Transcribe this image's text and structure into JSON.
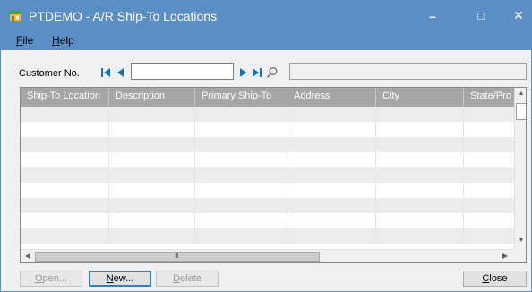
{
  "window": {
    "title": "PTDEMO - A/R Ship-To Locations",
    "minimize_glyph": "–",
    "maximize_glyph": "□",
    "close_glyph": "✕"
  },
  "menu": {
    "file": {
      "underline": "F",
      "rest": "ile"
    },
    "help": {
      "underline": "H",
      "rest": "elp"
    }
  },
  "customer": {
    "label": "Customer No.",
    "value": "",
    "name_value": ""
  },
  "icons": {
    "first": "first-record-icon",
    "previous": "previous-record-icon",
    "next": "next-record-icon",
    "last": "last-record-icon",
    "lookup": "lookup-magnifier-icon"
  },
  "colors": {
    "title_bar": "#5a8ec4",
    "nav_arrow": "#1a6fb5",
    "grid_header": "#a6a6a6"
  },
  "grid": {
    "columns": [
      "Ship-To Location",
      "Description",
      "Primary Ship-To",
      "Address",
      "City",
      "State/Pro"
    ],
    "scroll_up": "▲",
    "scroll_down": "▼",
    "scroll_left": "◀",
    "scroll_right": "▶",
    "grip": "III"
  },
  "buttons": {
    "open": {
      "underline": "O",
      "rest": "pen..."
    },
    "new": {
      "underline": "N",
      "rest": "ew..."
    },
    "delete": {
      "underline": "D",
      "rest": "elete"
    },
    "close": {
      "underline": "C",
      "rest": "lose"
    }
  }
}
